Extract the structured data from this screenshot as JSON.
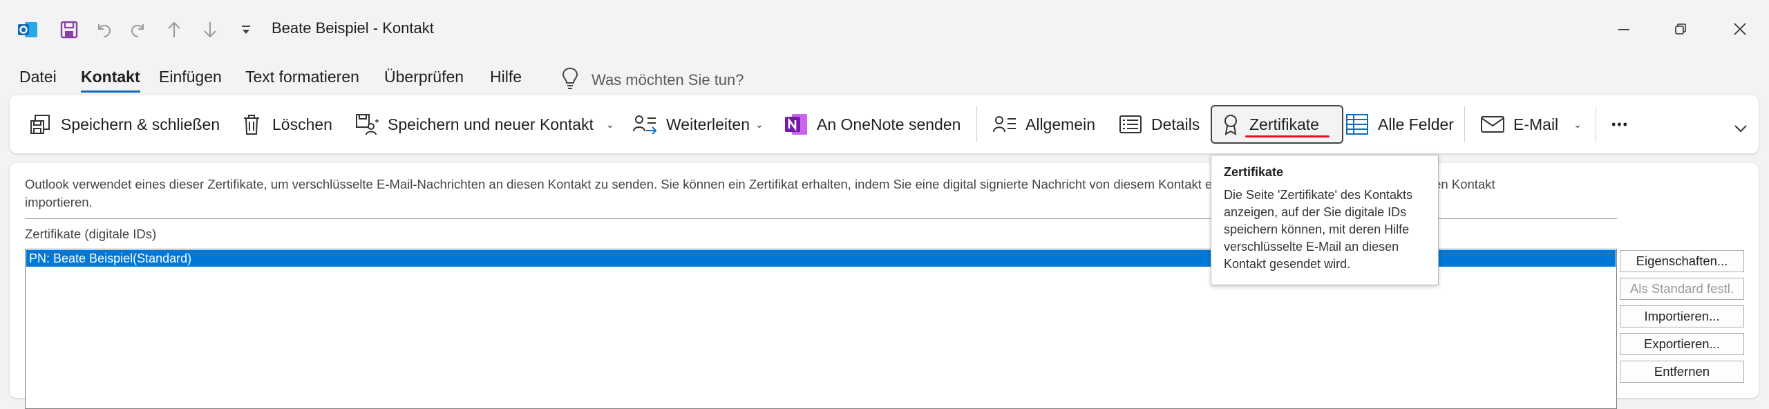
{
  "window": {
    "title": "Beate Beispiel  -  Kontakt",
    "minimize_icon": "minimize-icon",
    "restore_icon": "restore-icon",
    "close_icon": "close-icon"
  },
  "menu_tabs": [
    {
      "label": "Datei"
    },
    {
      "label": "Kontakt"
    },
    {
      "label": "Einfügen"
    },
    {
      "label": "Text formatieren"
    },
    {
      "label": "Überprüfen"
    },
    {
      "label": "Hilfe"
    }
  ],
  "active_tab": "Kontakt",
  "tell_me": {
    "placeholder": "Was möchten Sie tun?"
  },
  "ribbon": {
    "save_close": "Speichern & schließen",
    "delete": "Löschen",
    "save_new": "Speichern und neuer Kontakt",
    "forward": "Weiterleiten",
    "onenote": "An OneNote senden",
    "general": "Allgemein",
    "details": "Details",
    "certificates": "Zertifikate",
    "all_fields": "Alle Felder",
    "email": "E-Mail",
    "more": "•••"
  },
  "panel": {
    "description_line1": "Outlook verwendet eines dieser Zertifikate, um verschlüsselte E-Mail-Nachrichten an diesen Kontakt zu senden. Sie können ein Zertifikat erhalten, indem Sie eine digital signierte Nachricht von diesem Kontakt erhalten oder eine Zertifikatdatei für diesen Kontakt",
    "description_line2": "importieren.",
    "list_label": "Zertifikate (digitale IDs)",
    "certificates": [
      "PN: Beate Beispiel(Standard)"
    ],
    "buttons": {
      "properties": "Eigenschaften...",
      "set_default": "Als Standard festl.",
      "import": "Importieren...",
      "export": "Exportieren...",
      "remove": "Entfernen"
    }
  },
  "tooltip": {
    "title": "Zertifikate",
    "body": "Die Seite 'Zertifikate' des Kontakts anzeigen, auf der Sie digitale IDs speichern können, mit deren Hilfe verschlüsselte E-Mail an diesen Kontakt gesendet wird."
  },
  "colors": {
    "accent": "#0f6cbd",
    "selection": "#0078d7",
    "onenote": "#7719aa",
    "outlook": "#0f6cbd",
    "save_purple": "#8a3ea8",
    "underline_red": "#e81123"
  }
}
